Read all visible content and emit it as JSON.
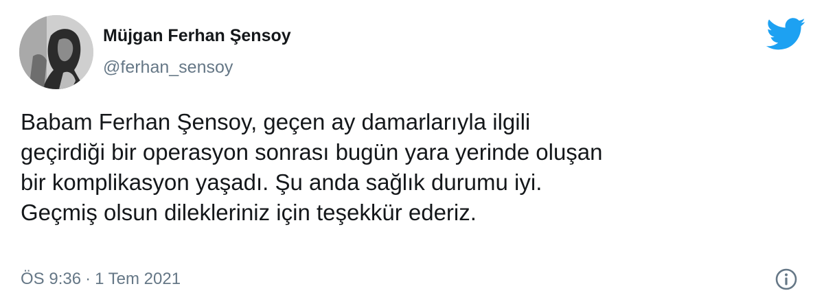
{
  "colors": {
    "text_primary": "#14171a",
    "text_secondary": "#657786",
    "twitter_blue": "#1da1f2"
  },
  "author": {
    "display_name": "Müjgan Ferhan Şensoy",
    "handle": "@ferhan_sensoy",
    "avatar_icon": "profile-photo"
  },
  "brand": {
    "icon": "twitter-bird-icon"
  },
  "tweet": {
    "lines": [
      "Babam Ferhan Şensoy, geçen ay damarlarıyla ilgili",
      "geçirdiği bir operasyon sonrası bugün yara yerinde oluşan",
      "bir komplikasyon yaşadı. Şu anda sağlık durumu iyi.",
      "Geçmiş olsun dilekleriniz için teşekkür ederiz."
    ]
  },
  "meta": {
    "time": "ÖS 9:36",
    "separator": "·",
    "date": "1 Tem 2021",
    "info_icon": "info-icon"
  }
}
